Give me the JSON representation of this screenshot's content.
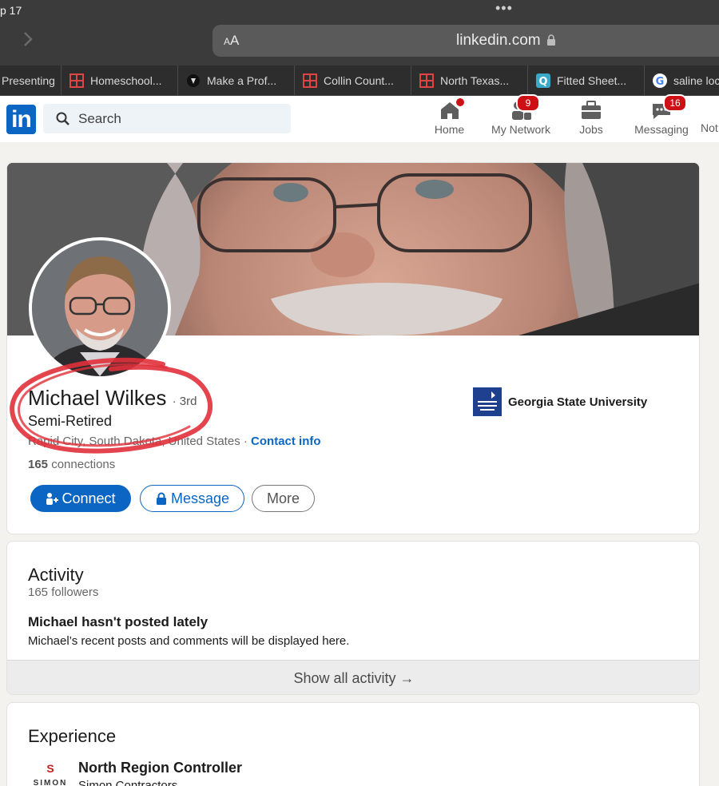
{
  "browser": {
    "status_time": "p 17",
    "dots": "•••",
    "text_size_label_small": "A",
    "text_size_label_large": "A",
    "url": "linkedin.com",
    "tabs": [
      {
        "label": "Presenting",
        "icon": "none"
      },
      {
        "label": "Homeschool...",
        "icon": "grid-icon"
      },
      {
        "label": "Make a Prof...",
        "icon": "shield-icon"
      },
      {
        "label": "Collin Count...",
        "icon": "grid-icon"
      },
      {
        "label": "North Texas...",
        "icon": "grid-icon"
      },
      {
        "label": "Fitted Sheet...",
        "icon": "q-icon"
      },
      {
        "label": "saline loc",
        "icon": "google-icon"
      }
    ]
  },
  "header": {
    "logo": "in",
    "search_placeholder": "Search",
    "nav": [
      {
        "label": "Home",
        "icon": "home-icon",
        "badge": ""
      },
      {
        "label": "My Network",
        "icon": "network-icon",
        "badge": "9"
      },
      {
        "label": "Jobs",
        "icon": "briefcase-icon",
        "badge": ""
      },
      {
        "label": "Messaging",
        "icon": "messaging-icon",
        "badge": "16"
      },
      {
        "label": "Not",
        "icon": "",
        "badge": ""
      }
    ]
  },
  "profile": {
    "name": "Michael Wilkes",
    "degree": "· 3rd",
    "headline": "Semi-Retired",
    "location": "Rapid City, South Dakota, United States",
    "location_sep": " · ",
    "contact_info": "Contact info",
    "connections_count": "165",
    "connections_label": " connections",
    "education": "Georgia State University",
    "buttons": {
      "connect": "Connect",
      "message": "Message",
      "more": "More"
    }
  },
  "activity": {
    "title": "Activity",
    "followers": "165 followers",
    "empty_title": "Michael hasn't posted lately",
    "empty_sub": "Michael’s recent posts and comments will be displayed here.",
    "show_all": "Show all activity →"
  },
  "experience": {
    "title": "Experience",
    "items": [
      {
        "role": "North Region Controller",
        "company": "Simon Contractors",
        "logo_top": "S",
        "logo_word": "SIMON"
      }
    ]
  },
  "colors": {
    "brand": "#0a66c2",
    "badge": "#cc1016",
    "annotation": "#e0303a"
  }
}
